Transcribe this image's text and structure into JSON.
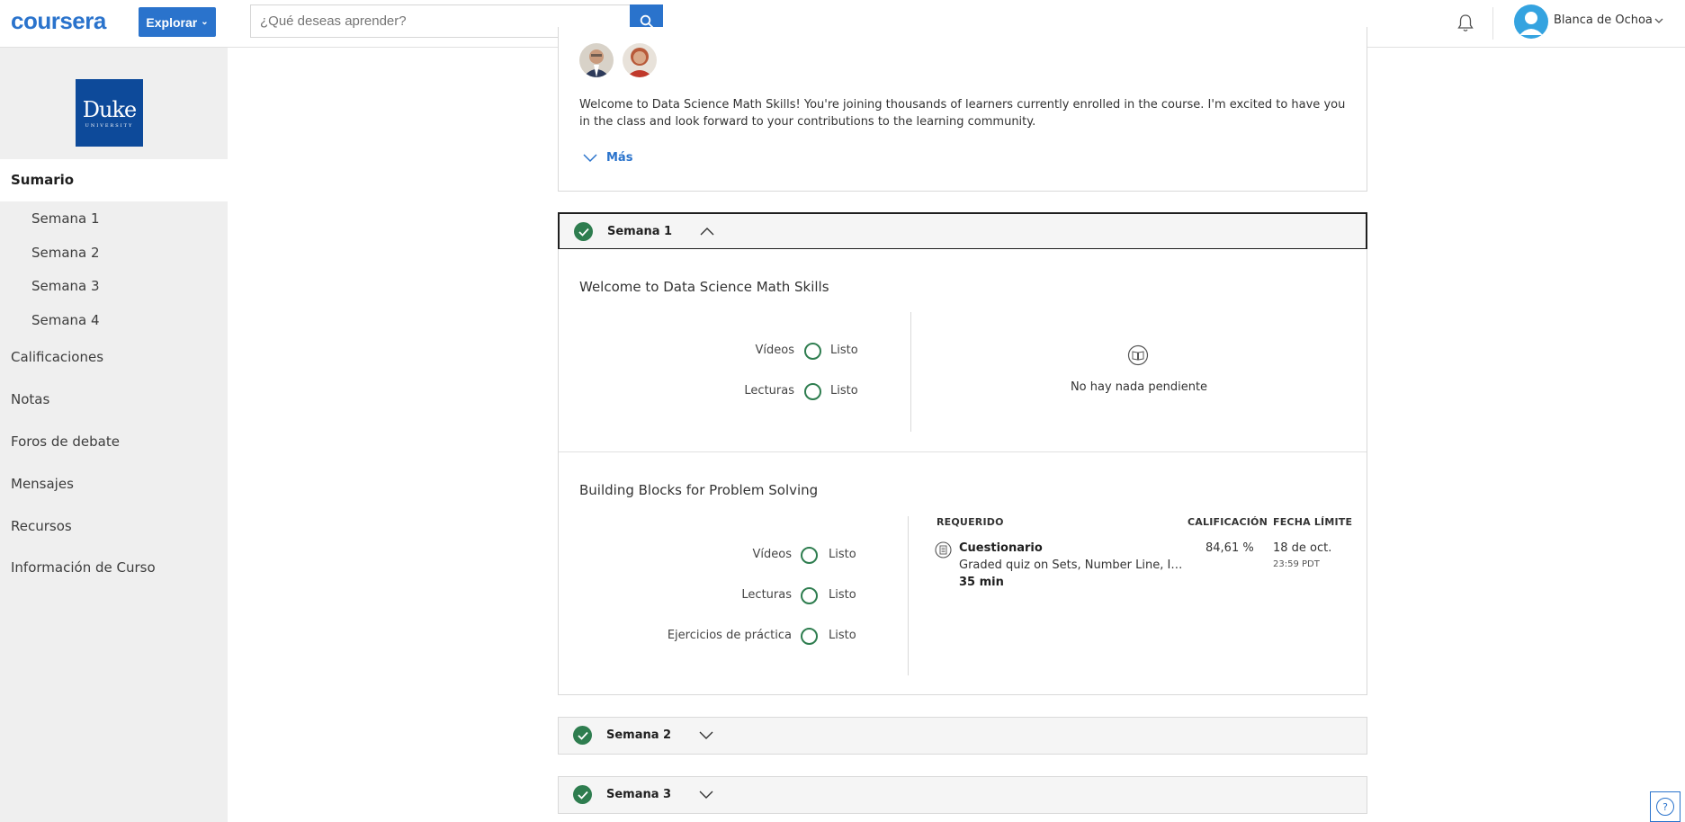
{
  "header": {
    "logo": "coursera",
    "explore_label": "Explorar",
    "search_placeholder": "¿Qué deseas aprender?",
    "user_name": "Blanca de Ochoa",
    "accent": "#2a73cc"
  },
  "sidebar": {
    "university_logo": "Duke",
    "university_sub": "UNIVERSITY",
    "active_item": "Sumario",
    "weeks": [
      "Semana 1",
      "Semana 2",
      "Semana 3",
      "Semana 4"
    ],
    "items": [
      "Calificaciones",
      "Notas",
      "Foros de debate",
      "Mensajes",
      "Recursos",
      "Información de Curso"
    ]
  },
  "intro": {
    "text": "Welcome to Data Science Math Skills! You're joining thousands of learners currently enrolled in the course. I'm excited to have you in the class and look forward to your contributions to the learning community.",
    "more_label": "Más"
  },
  "weeks": [
    {
      "title": "Semana 1",
      "expanded": true
    },
    {
      "title": "Semana 2",
      "expanded": false
    },
    {
      "title": "Semana 3",
      "expanded": false
    }
  ],
  "lesson1": {
    "title": "Welcome to Data Science Math Skills",
    "progress": [
      {
        "label": "Vídeos",
        "status": "Listo"
      },
      {
        "label": "Lecturas",
        "status": "Listo"
      }
    ],
    "empty_message": "No hay nada pendiente"
  },
  "lesson2": {
    "title": "Building Blocks for Problem Solving",
    "progress": [
      {
        "label": "Vídeos",
        "status": "Listo"
      },
      {
        "label": "Lecturas",
        "status": "Listo"
      },
      {
        "label": "Ejercicios de práctica",
        "status": "Listo"
      }
    ],
    "table": {
      "col_required": "REQUERIDO",
      "col_grade": "CALIFICACIÓN",
      "col_due": "FECHA LÍMITE",
      "item_type": "Cuestionario",
      "item_desc": "Graded quiz on Sets, Number Line, Inequalities, Simplification, and Sigma Notation",
      "item_time": "35 min",
      "grade": "84,61 %",
      "due_date": "18 de oct.",
      "due_time": "23:59 PDT"
    }
  },
  "status_color": "#2e7d4f",
  "help_icon": "?"
}
